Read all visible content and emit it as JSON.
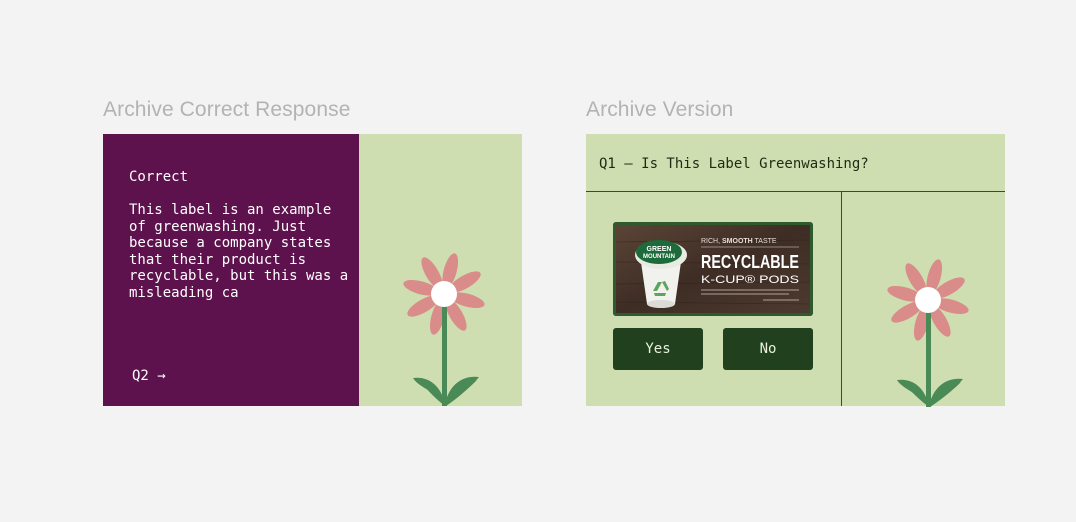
{
  "frames": [
    {
      "title": "Archive Correct Response",
      "heading": "Correct",
      "body": "This label is an example of greenwashing. Just because a company states that their product is recyclable, but this was a misleading ca",
      "next_label": "Q2 →"
    },
    {
      "title": "Archive Version",
      "question": "Q1 – Is This Label Greenwashing?",
      "product_label": {
        "brand_line1": "GREEN",
        "brand_line2": "MOUNTAIN",
        "tagline_a": "RICH, ",
        "tagline_b": "SMOOTH",
        "tagline_c": " TASTE",
        "headline": "RECYCLABLE",
        "subline": "K-CUP® PODS"
      },
      "yes_label": "Yes",
      "no_label": "No"
    }
  ],
  "colors": {
    "background": "#f3f3f3",
    "panel_purple": "#5e124d",
    "sage": "#cfdeb0",
    "button_green": "#21411e",
    "petal": "#d98c8a",
    "stem": "#4a8a56"
  }
}
